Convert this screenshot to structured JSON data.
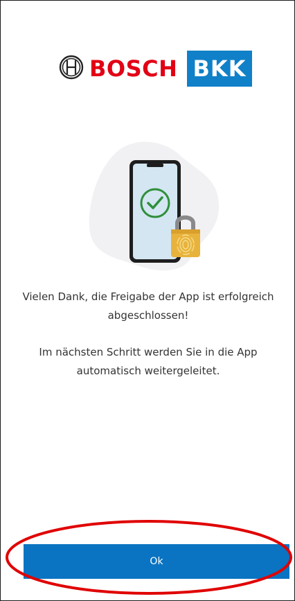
{
  "brand": {
    "bosch_text": "BOSCH",
    "bkk_text": "BKK",
    "colors": {
      "bosch_red": "#e20015",
      "bkk_blue": "#1080c8"
    }
  },
  "illustration": {
    "icons": [
      "smartphone-icon",
      "checkmark-circle-icon",
      "padlock-fingerprint-icon"
    ],
    "colors": {
      "check_green": "#2f8f3a",
      "lock_gold": "#e8b33c"
    }
  },
  "message": {
    "line1": "Vielen Dank, die Freigabe der App ist erfolgreich abgeschlossen!",
    "line2": "Im nächsten Schritt werden Sie in die App automatisch weitergeleitet."
  },
  "actions": {
    "ok_label": "Ok",
    "button_color": "#0a74c2"
  },
  "annotation": {
    "color": "#e00000"
  }
}
